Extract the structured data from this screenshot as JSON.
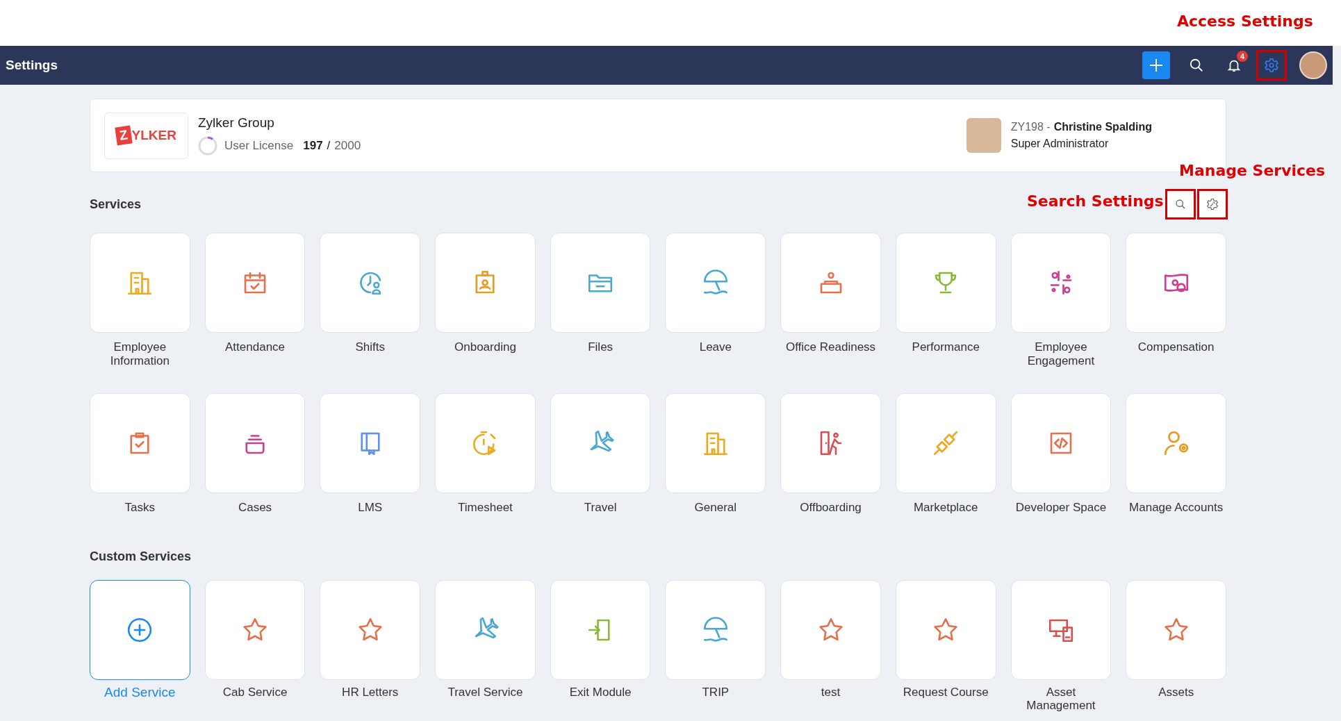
{
  "annotations": [
    {
      "text": "Access Settings",
      "kind": "access"
    },
    {
      "text": "Manage Services",
      "kind": "manage"
    },
    {
      "text": "Search Settings",
      "kind": "search"
    }
  ],
  "top_bar": {
    "title": "Settings",
    "actions": [
      {
        "kind": "add",
        "highlighted": false
      },
      {
        "kind": "search",
        "highlighted": false
      },
      {
        "kind": "notifications",
        "badge": "4",
        "highlighted": false
      },
      {
        "kind": "settings",
        "highlighted": true
      },
      {
        "kind": "avatar",
        "highlighted": false
      }
    ]
  },
  "organization": {
    "logo_initial": "Z",
    "logo_rest": "YLKER",
    "name": "Zylker Group",
    "license": {
      "label": "User License",
      "used": "197",
      "separator": "/",
      "total": "2000",
      "level": 0.0985
    },
    "user": {
      "id": "ZY198 -",
      "name": "Christine Spalding",
      "role": "Super Administrator"
    }
  },
  "services": {
    "title": "Services",
    "tools": [
      {
        "kind": "search",
        "highlighted": true
      },
      {
        "kind": "manage",
        "highlighted": true
      }
    ],
    "items": [
      {
        "label": "Employee Information",
        "color": "#f0a81e"
      },
      {
        "label": "Attendance",
        "color": "#e6704a"
      },
      {
        "label": "Shifts",
        "color": "#4aa8d0"
      },
      {
        "label": "Onboarding",
        "color": "#e99a20"
      },
      {
        "label": "Files",
        "color": "#4aa8d0"
      },
      {
        "label": "Leave",
        "color": "#4aa8d0"
      },
      {
        "label": "Office Readiness",
        "color": "#e6704a"
      },
      {
        "label": "Performance",
        "color": "#8cb83a"
      },
      {
        "label": "Employee Engagement",
        "color": "#cc3d8f"
      },
      {
        "label": "Compensation",
        "color": "#cc3d8f"
      },
      {
        "label": "Tasks",
        "color": "#e6704a"
      },
      {
        "label": "Cases",
        "color": "#cc3d8f"
      },
      {
        "label": "LMS",
        "color": "#5b8ff0"
      },
      {
        "label": "Timesheet",
        "color": "#f0a81e"
      },
      {
        "label": "Travel",
        "color": "#4aa8d0"
      },
      {
        "label": "General",
        "color": "#f0a81e"
      },
      {
        "label": "Offboarding",
        "color": "#d94f4f"
      },
      {
        "label": "Marketplace",
        "color": "#f0a81e"
      },
      {
        "label": "Developer Space",
        "color": "#e6704a"
      },
      {
        "label": "Manage Accounts",
        "color": "#e99a20"
      }
    ]
  },
  "custom_services": {
    "title": "Custom Services",
    "items": [
      {
        "label": "Add Service",
        "color": "#1a88f0",
        "kind": "add"
      },
      {
        "label": "Cab Service",
        "color": "#e6704a",
        "kind": "service"
      },
      {
        "label": "HR Letters",
        "color": "#e6704a",
        "kind": "service"
      },
      {
        "label": "Travel Service",
        "color": "#4aa8d0",
        "kind": "service"
      },
      {
        "label": "Exit Module",
        "color": "#8cb83a",
        "kind": "service"
      },
      {
        "label": "TRIP",
        "color": "#4aa8d0",
        "kind": "service"
      },
      {
        "label": "test",
        "color": "#e6704a",
        "kind": "service"
      },
      {
        "label": "Request Course",
        "color": "#e6704a",
        "kind": "service"
      },
      {
        "label": "Asset Management",
        "color": "#d94f4f",
        "kind": "service"
      },
      {
        "label": "Assets",
        "color": "#e6704a",
        "kind": "service"
      }
    ]
  }
}
